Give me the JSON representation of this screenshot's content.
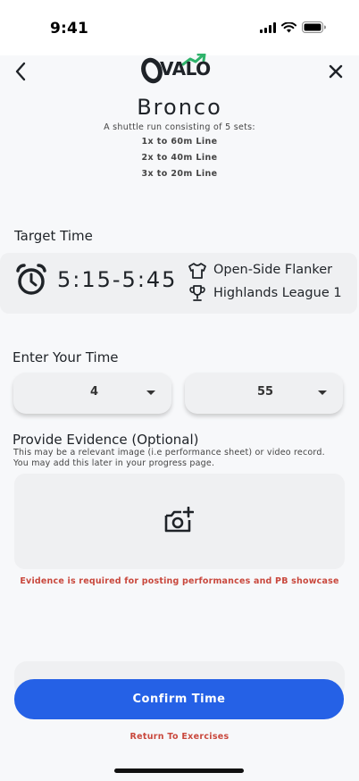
{
  "status_bar": {
    "time": "9:41"
  },
  "header": {
    "logo_text": "VALO"
  },
  "exercise": {
    "title": "Bronco",
    "description": "A shuttle run consisting of 5 sets:",
    "sets": [
      "1x to 60m Line",
      "2x to 40m Line",
      "3x to 20m Line"
    ]
  },
  "target": {
    "label": "Target Time",
    "time_range": "5:15-5:45",
    "position": "Open-Side Flanker",
    "league": "Highlands League 1"
  },
  "entry": {
    "label": "Enter Your Time",
    "minutes_value": "4",
    "seconds_value": "55"
  },
  "evidence": {
    "label": "Provide Evidence (Optional)",
    "subtext_line1": "This may be a relevant image (i.e performance sheet) or video record.",
    "subtext_line2": "You may add this later in your progress page.",
    "error": "Evidence is required for posting performances and PB showcase"
  },
  "actions": {
    "confirm_label": "Confirm Time",
    "return_label": "Return To Exercises"
  },
  "colors": {
    "primary": "#2561e6",
    "error": "#c9483d",
    "logo_accent": "#2fb36b",
    "card_bg": "#eff0f2"
  }
}
